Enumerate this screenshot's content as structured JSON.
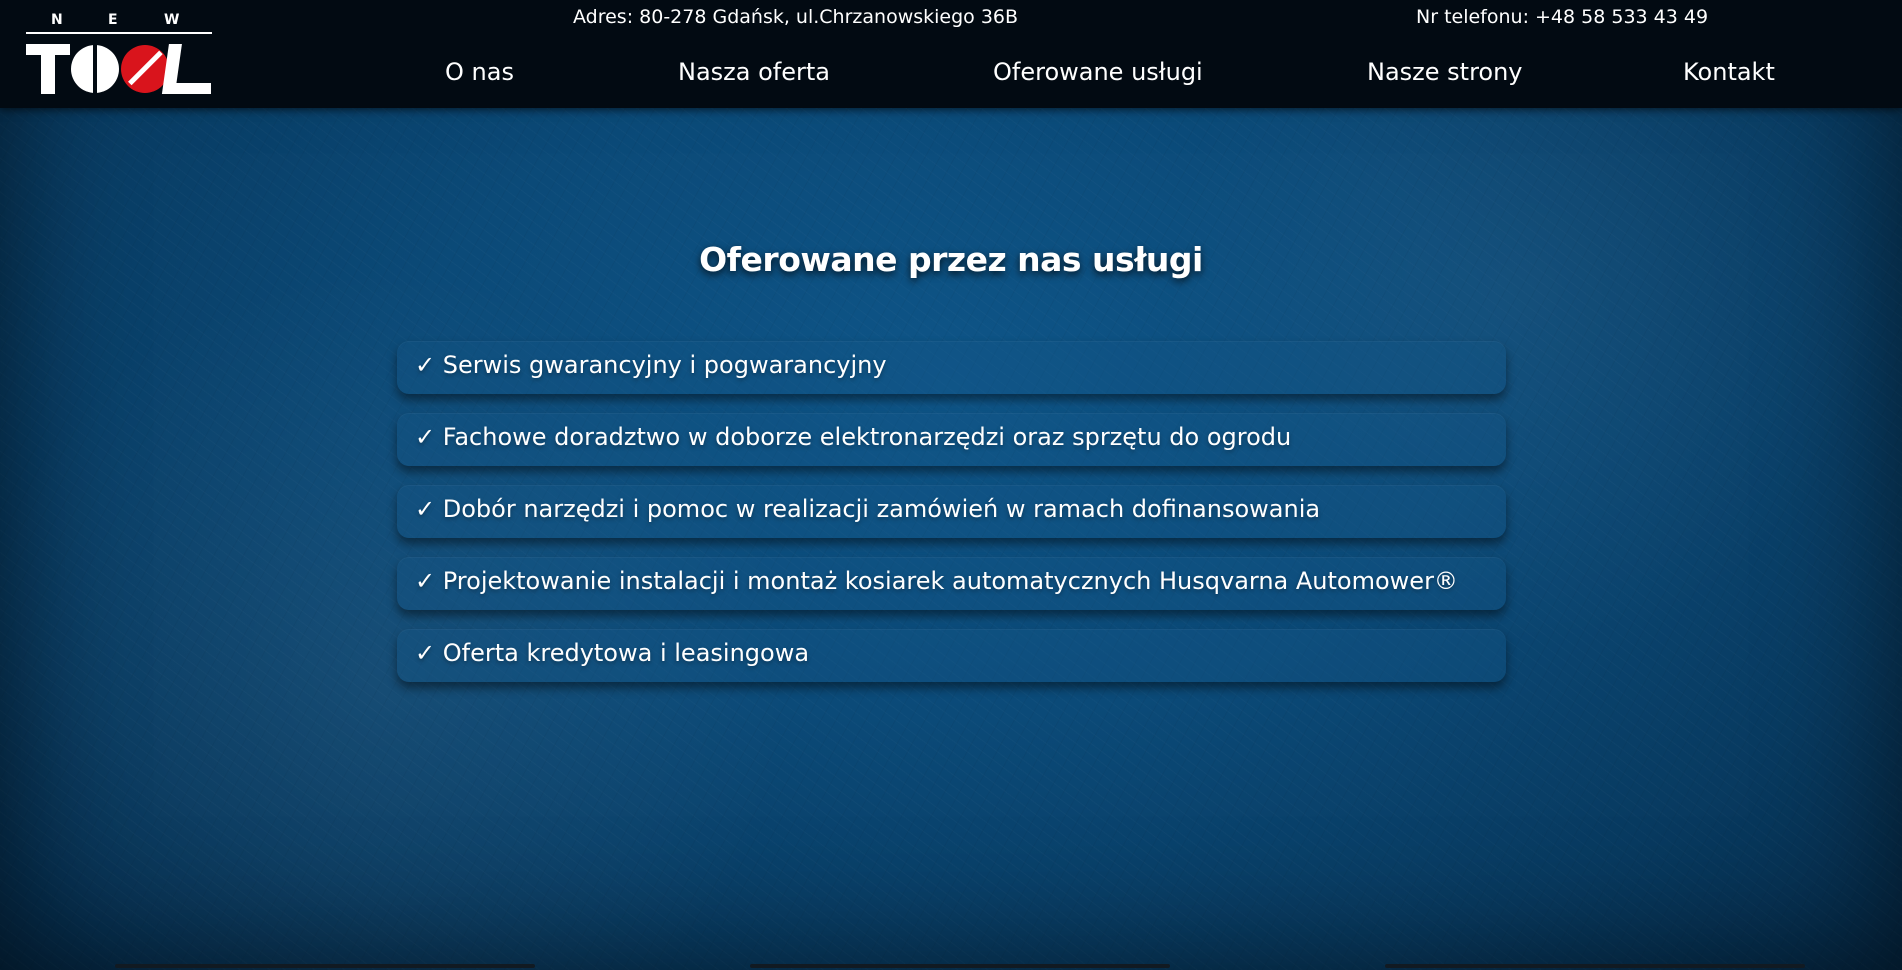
{
  "brand": {
    "logo_top": "N E W",
    "logo_main": "TOOL",
    "accent": "#d9141c"
  },
  "header": {
    "address": "Adres: 80-278 Gdańsk, ul.Chrzanowskiego 36B",
    "phone": "Nr telefonu: +48 58 533 43 49"
  },
  "nav": {
    "items": [
      {
        "label": "O nas"
      },
      {
        "label": "Nasza oferta"
      },
      {
        "label": "Oferowane usługi"
      },
      {
        "label": "Nasze strony"
      },
      {
        "label": "Kontakt"
      }
    ]
  },
  "main": {
    "title": "Oferowane przez nas usługi",
    "services": [
      {
        "text": "✓ Serwis gwarancyjny i pogwarancyjny"
      },
      {
        "text": "✓ Fachowe doradztwo w doborze elektronarzędzi oraz sprzętu do ogrodu"
      },
      {
        "text": "✓ Dobór narzędzi i pomoc w realizacji zamówień w ramach dofinansowania"
      },
      {
        "text": "✓ Projektowanie instalacji i montaż kosiarek automatycznych Husqvarna Automower®"
      },
      {
        "text": "✓ Oferta kredytowa i leasingowa"
      }
    ]
  },
  "colors": {
    "header_bg": "#020a12",
    "page_bg": "#0d4a73",
    "text": "#ffffff"
  }
}
